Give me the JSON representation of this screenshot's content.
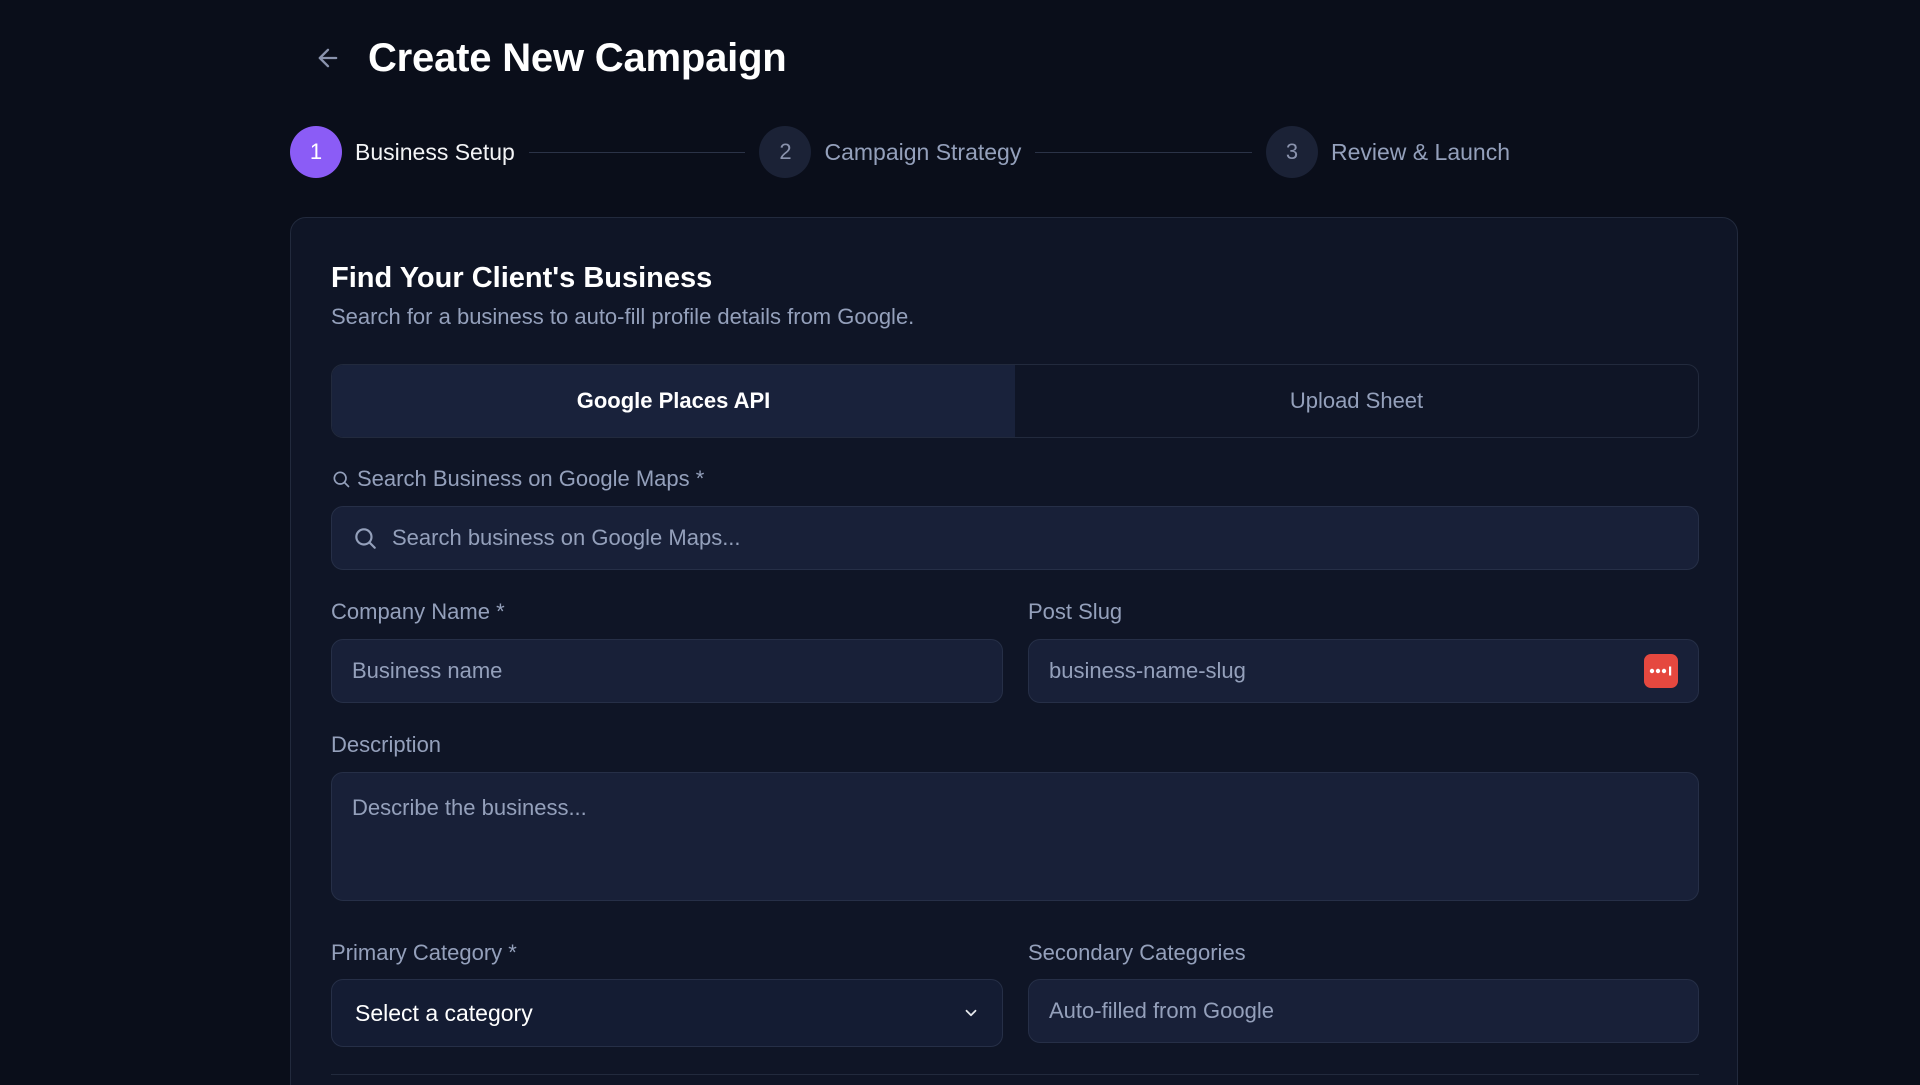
{
  "header": {
    "title": "Create New Campaign",
    "back_icon": "arrow-left-icon"
  },
  "stepper": {
    "steps": [
      {
        "number": "1",
        "label": "Business Setup",
        "active": true
      },
      {
        "number": "2",
        "label": "Campaign Strategy",
        "active": false
      },
      {
        "number": "3",
        "label": "Review & Launch",
        "active": false
      }
    ]
  },
  "card": {
    "title": "Find Your Client's Business",
    "subtitle": "Search for a business to auto-fill profile details from Google.",
    "tabs": [
      {
        "label": "Google Places API",
        "active": true
      },
      {
        "label": "Upload Sheet",
        "active": false
      }
    ]
  },
  "form": {
    "search": {
      "label": "Search Business on Google Maps *",
      "placeholder": "Search business on Google Maps...",
      "icon": "search-icon"
    },
    "company_name": {
      "label": "Company Name *",
      "placeholder": "Business name"
    },
    "post_slug": {
      "label": "Post Slug",
      "placeholder": "business-name-slug",
      "badge_icon": "password-manager-icon"
    },
    "description": {
      "label": "Description",
      "placeholder": "Describe the business..."
    },
    "primary_category": {
      "label": "Primary Category *",
      "selected": "Select a category",
      "icon": "chevron-down-icon"
    },
    "secondary_categories": {
      "label": "Secondary Categories",
      "placeholder": "Auto-filled from Google"
    }
  },
  "colors": {
    "background": "#0a0e1a",
    "card": "#0f1526",
    "accent": "#8b5cf6",
    "badge": "#e5483f"
  }
}
